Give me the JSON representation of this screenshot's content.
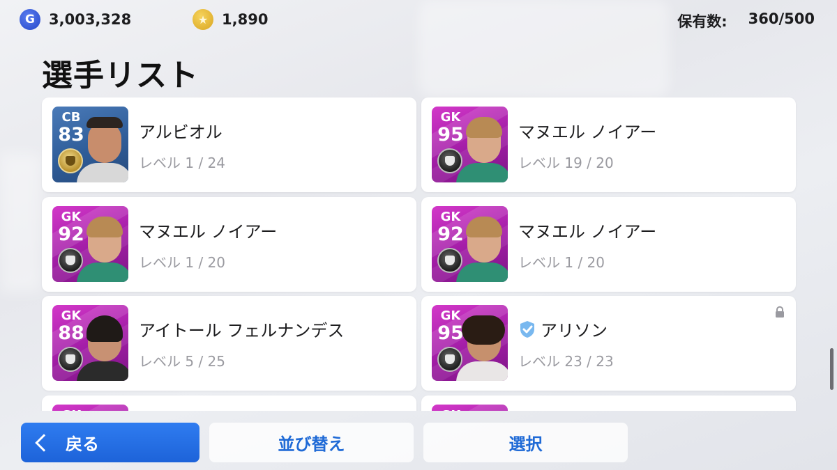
{
  "header": {
    "gp_icon": "G",
    "gp_value": "3,003,328",
    "coin_icon": "★",
    "coin_value": "1,890",
    "owned_label": "保有数:",
    "owned_value": "360/500"
  },
  "title": "選手リスト",
  "players": [
    {
      "position": "CB",
      "rating": "83",
      "name": "アルビオル",
      "level": "レベル 1 / 24"
    },
    {
      "position": "GK",
      "rating": "95",
      "name": "マヌエル ノイアー",
      "level": "レベル 19 / 20"
    },
    {
      "position": "GK",
      "rating": "92",
      "name": "マヌエル ノイアー",
      "level": "レベル 1 / 20"
    },
    {
      "position": "GK",
      "rating": "92",
      "name": "マヌエル ノイアー",
      "level": "レベル 1 / 20"
    },
    {
      "position": "GK",
      "rating": "88",
      "name": "アイトール フェルナンデス",
      "level": "レベル 5 / 25"
    },
    {
      "position": "GK",
      "rating": "95",
      "name": "アリソン",
      "level": "レベル 23 / 23",
      "locked": true,
      "shield_icon": "shield-check-icon"
    },
    {
      "position": "GK",
      "rating": "",
      "name": "",
      "level": ""
    },
    {
      "position": "GK",
      "rating": "",
      "name": "",
      "level": ""
    }
  ],
  "buttons": {
    "back": "戻る",
    "sort": "並び替え",
    "select": "選択"
  },
  "colors": {
    "accent": "#1f6ad6",
    "back_button": "#2a74ea",
    "gk_card": "#b926b4",
    "cb_card": "#3a6aa8"
  }
}
